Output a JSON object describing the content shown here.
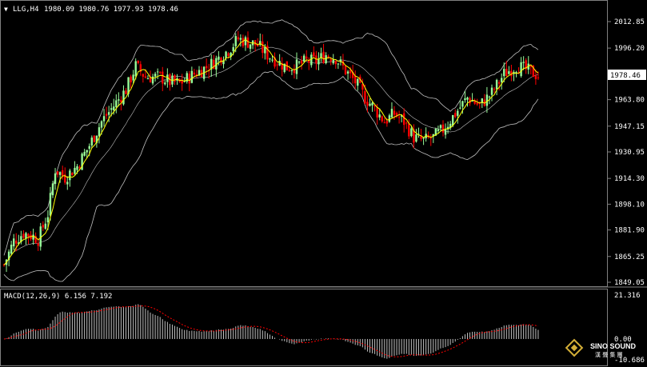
{
  "header": {
    "symbol": "LLG,H4",
    "ohlc": "1980.09 1980.76 1977.93 1978.46"
  },
  "macd": {
    "label": "MACD(12,26,9) 6.156 7.192",
    "axis_top": "21.316",
    "axis_zero": "0.00",
    "axis_bottom": "-10.686"
  },
  "logo": {
    "name": "SINO SOUND",
    "subtitle": "漢 聲 集 團"
  },
  "colors": {
    "background": "#000000",
    "bull": "#98fb98",
    "bear": "#ff0000",
    "ma": "#ffff00",
    "bands": "#c0c0c0",
    "signal": "#ff0000",
    "hist": "#c0c0c0"
  },
  "chart_data": {
    "type": "candlestick",
    "price_axis": {
      "ticks": [
        2012.85,
        1996.2,
        1979.55,
        1963.8,
        1947.15,
        1930.95,
        1914.3,
        1898.1,
        1881.9,
        1865.25,
        1849.05
      ],
      "ylim": [
        1849.05,
        2012.85
      ],
      "current_price": 1978.46
    },
    "anchors": [
      [
        0,
        1860
      ],
      [
        4,
        1875
      ],
      [
        8,
        1880
      ],
      [
        12,
        1878
      ],
      [
        14,
        1876
      ],
      [
        18,
        1892
      ],
      [
        21,
        1920
      ],
      [
        25,
        1915
      ],
      [
        30,
        1922
      ],
      [
        35,
        1935
      ],
      [
        40,
        1950
      ],
      [
        45,
        1960
      ],
      [
        50,
        1970
      ],
      [
        54,
        1985
      ],
      [
        58,
        1978
      ],
      [
        64,
        1978
      ],
      [
        68,
        1975
      ],
      [
        72,
        1974
      ],
      [
        78,
        1980
      ],
      [
        84,
        1985
      ],
      [
        88,
        1990
      ],
      [
        92,
        1995
      ],
      [
        96,
        2002
      ],
      [
        100,
        2000
      ],
      [
        104,
        1998
      ],
      [
        108,
        1992
      ],
      [
        112,
        1988
      ],
      [
        116,
        1984
      ],
      [
        120,
        1985
      ],
      [
        124,
        1988
      ],
      [
        128,
        1988
      ],
      [
        132,
        1992
      ],
      [
        136,
        1990
      ],
      [
        140,
        1982
      ],
      [
        144,
        1975
      ],
      [
        148,
        1965
      ],
      [
        152,
        1958
      ],
      [
        156,
        1950
      ],
      [
        160,
        1955
      ],
      [
        164,
        1950
      ],
      [
        168,
        1940
      ],
      [
        172,
        1938
      ],
      [
        176,
        1940
      ],
      [
        180,
        1945
      ],
      [
        185,
        1955
      ],
      [
        190,
        1965
      ],
      [
        195,
        1960
      ],
      [
        200,
        1968
      ],
      [
        205,
        1980
      ],
      [
        210,
        1985
      ],
      [
        215,
        1982
      ],
      [
        220,
        1978
      ]
    ]
  }
}
